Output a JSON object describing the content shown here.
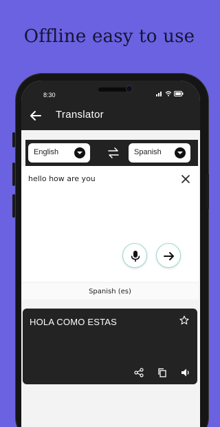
{
  "promo": {
    "headline": "Offline easy to use"
  },
  "status_bar": {
    "time": "8:30"
  },
  "app_bar": {
    "title": "Translator",
    "icons": [
      "back-arrow-icon"
    ]
  },
  "languages": {
    "source": "English",
    "target": "Spanish",
    "icons": [
      "dropdown-icon",
      "swap-icon"
    ]
  },
  "input": {
    "value": "hello how are you",
    "icons": [
      "clear-icon",
      "microphone-icon",
      "translate-arrow-icon"
    ]
  },
  "output": {
    "language_label": "Spanish (es)",
    "text": "HOLA COMO ESTAS",
    "icons": [
      "star-icon",
      "share-icon",
      "copy-icon",
      "speaker-icon"
    ]
  },
  "colors": {
    "background": "#6a62e0",
    "dark_bar": "#222222",
    "accent_ring": "#9ed8d2"
  }
}
